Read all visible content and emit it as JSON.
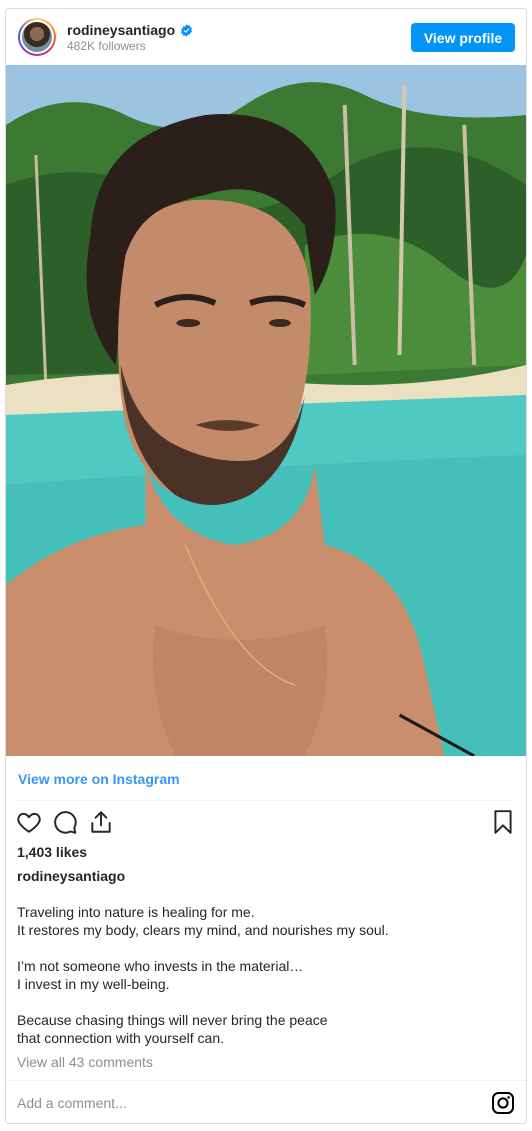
{
  "header": {
    "username": "rodineysantiago",
    "verified": true,
    "followers": "482K followers",
    "view_profile_label": "View profile"
  },
  "post": {
    "photo_icon": "selfie-photo",
    "view_more_label": "View more on Instagram",
    "likes": "1,403 likes",
    "caption_user": "rodineysantiago",
    "caption_lines": [
      "Traveling into nature is healing for me.",
      "It restores my body, clears my mind, and nourishes my soul.",
      "",
      "I’m not someone who invests in the material…",
      "I invest in my well-being.",
      "",
      "Because chasing things will never bring the peace",
      "that connection with yourself can."
    ],
    "comments_link": "View all 43 comments",
    "add_comment_placeholder": "Add a comment..."
  },
  "icons": {
    "like": "heart-icon",
    "comment": "comment-icon",
    "share": "share-icon",
    "save": "bookmark-icon",
    "verified": "verified-badge-icon",
    "instagram": "instagram-logo-icon"
  },
  "colors": {
    "accent": "#0095f6",
    "link": "#3897f0",
    "muted": "#8e8e8e",
    "border": "#dbdbdb"
  }
}
